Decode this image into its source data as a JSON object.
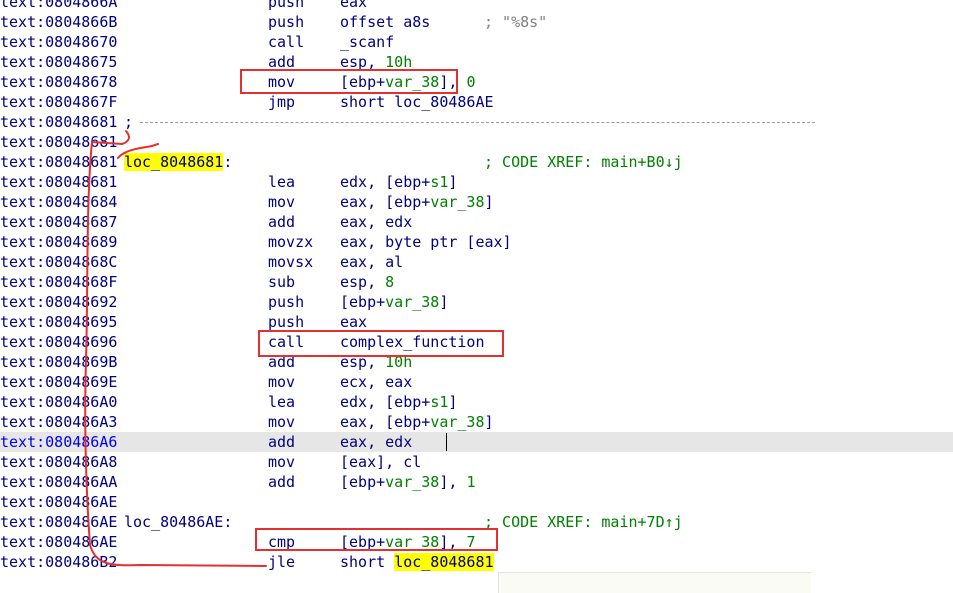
{
  "listing": {
    "rows": [
      {
        "addr": "text:0804866A",
        "mnem": "push",
        "ops": [
          {
            "t": "eax",
            "c": "op"
          }
        ]
      },
      {
        "addr": "text:0804866B",
        "mnem": "push",
        "ops": [
          {
            "t": "offset a8s",
            "c": "op"
          }
        ],
        "comment": "; \"%8s\"",
        "comment_class": "str"
      },
      {
        "addr": "text:08048670",
        "mnem": "call",
        "ops": [
          {
            "t": "_scanf",
            "c": "op"
          }
        ]
      },
      {
        "addr": "text:08048675",
        "mnem": "add",
        "ops": [
          {
            "t": "esp, ",
            "c": "op"
          },
          {
            "t": "10h",
            "c": "num"
          }
        ]
      },
      {
        "addr": "text:08048678",
        "mnem": "mov",
        "ops": [
          {
            "t": "[ebp+",
            "c": "op"
          },
          {
            "t": "var_38",
            "c": "num"
          },
          {
            "t": "], ",
            "c": "op"
          },
          {
            "t": "0",
            "c": "num"
          }
        ]
      },
      {
        "addr": "text:0804867F",
        "mnem": "jmp",
        "ops": [
          {
            "t": "short loc_80486AE",
            "c": "op"
          }
        ]
      },
      {
        "addr": "text:08048681",
        "sep": ";"
      },
      {
        "addr": "text:08048681"
      },
      {
        "addr": "text:08048681",
        "label": "loc_8048681",
        "label_hl": true,
        "label_suffix": ":",
        "comment": "; CODE XREF: main+B0↓j"
      },
      {
        "addr": "text:08048681",
        "mnem": "lea",
        "ops": [
          {
            "t": "edx, [ebp+",
            "c": "op"
          },
          {
            "t": "s1",
            "c": "num"
          },
          {
            "t": "]",
            "c": "op"
          }
        ]
      },
      {
        "addr": "text:08048684",
        "mnem": "mov",
        "ops": [
          {
            "t": "eax, [ebp+",
            "c": "op"
          },
          {
            "t": "var_38",
            "c": "num"
          },
          {
            "t": "]",
            "c": "op"
          }
        ]
      },
      {
        "addr": "text:08048687",
        "mnem": "add",
        "ops": [
          {
            "t": "eax, edx",
            "c": "op"
          }
        ]
      },
      {
        "addr": "text:08048689",
        "mnem": "movzx",
        "ops": [
          {
            "t": "eax, byte ptr [eax]",
            "c": "op"
          }
        ]
      },
      {
        "addr": "text:0804868C",
        "mnem": "movsx",
        "ops": [
          {
            "t": "eax, al",
            "c": "op"
          }
        ]
      },
      {
        "addr": "text:0804868F",
        "mnem": "sub",
        "ops": [
          {
            "t": "esp, ",
            "c": "op"
          },
          {
            "t": "8",
            "c": "num"
          }
        ]
      },
      {
        "addr": "text:08048692",
        "mnem": "push",
        "ops": [
          {
            "t": "[ebp+",
            "c": "op"
          },
          {
            "t": "var_38",
            "c": "num"
          },
          {
            "t": "]",
            "c": "op"
          }
        ]
      },
      {
        "addr": "text:08048695",
        "mnem": "push",
        "ops": [
          {
            "t": "eax",
            "c": "op"
          }
        ]
      },
      {
        "addr": "text:08048696",
        "mnem": "call",
        "ops": [
          {
            "t": "complex_function",
            "c": "op"
          }
        ]
      },
      {
        "addr": "text:0804869B",
        "mnem": "add",
        "ops": [
          {
            "t": "esp, ",
            "c": "op"
          },
          {
            "t": "10h",
            "c": "num"
          }
        ]
      },
      {
        "addr": "text:0804869E",
        "mnem": "mov",
        "ops": [
          {
            "t": "ecx, eax",
            "c": "op"
          }
        ]
      },
      {
        "addr": "text:080486A0",
        "mnem": "lea",
        "ops": [
          {
            "t": "edx, [ebp+",
            "c": "op"
          },
          {
            "t": "s1",
            "c": "num"
          },
          {
            "t": "]",
            "c": "op"
          }
        ]
      },
      {
        "addr": "text:080486A3",
        "mnem": "mov",
        "ops": [
          {
            "t": "eax, [ebp+",
            "c": "op"
          },
          {
            "t": "var_38",
            "c": "num"
          },
          {
            "t": "]",
            "c": "op"
          }
        ]
      },
      {
        "addr": "text:080486A6",
        "mnem": "add",
        "ops": [
          {
            "t": "eax, edx",
            "c": "op"
          }
        ],
        "current": true
      },
      {
        "addr": "text:080486A8",
        "mnem": "mov",
        "ops": [
          {
            "t": "[eax], cl",
            "c": "op"
          }
        ]
      },
      {
        "addr": "text:080486AA",
        "mnem": "add",
        "ops": [
          {
            "t": "[ebp+",
            "c": "op"
          },
          {
            "t": "var_38",
            "c": "num"
          },
          {
            "t": "], ",
            "c": "op"
          },
          {
            "t": "1",
            "c": "num"
          }
        ]
      },
      {
        "addr": "text:080486AE"
      },
      {
        "addr": "text:080486AE",
        "label": "loc_80486AE:",
        "comment": "; CODE XREF: main+7D↑j"
      },
      {
        "addr": "text:080486AE",
        "mnem": "cmp",
        "ops": [
          {
            "t": "[ebp+",
            "c": "op"
          },
          {
            "t": "var_38",
            "c": "num"
          },
          {
            "t": "], ",
            "c": "op"
          },
          {
            "t": "7",
            "c": "num"
          }
        ]
      },
      {
        "addr": "text:080486B2",
        "mnem": "jle",
        "ops": [
          {
            "t": "short ",
            "c": "op"
          },
          {
            "t": "loc_8048681",
            "c": "yl"
          }
        ]
      }
    ]
  },
  "colors": {
    "address": "#000080",
    "number": "#008000",
    "comment": "#008000",
    "highlight": "#ffff00",
    "current_line": "#e6e6e6",
    "annotation": "#e53030"
  }
}
